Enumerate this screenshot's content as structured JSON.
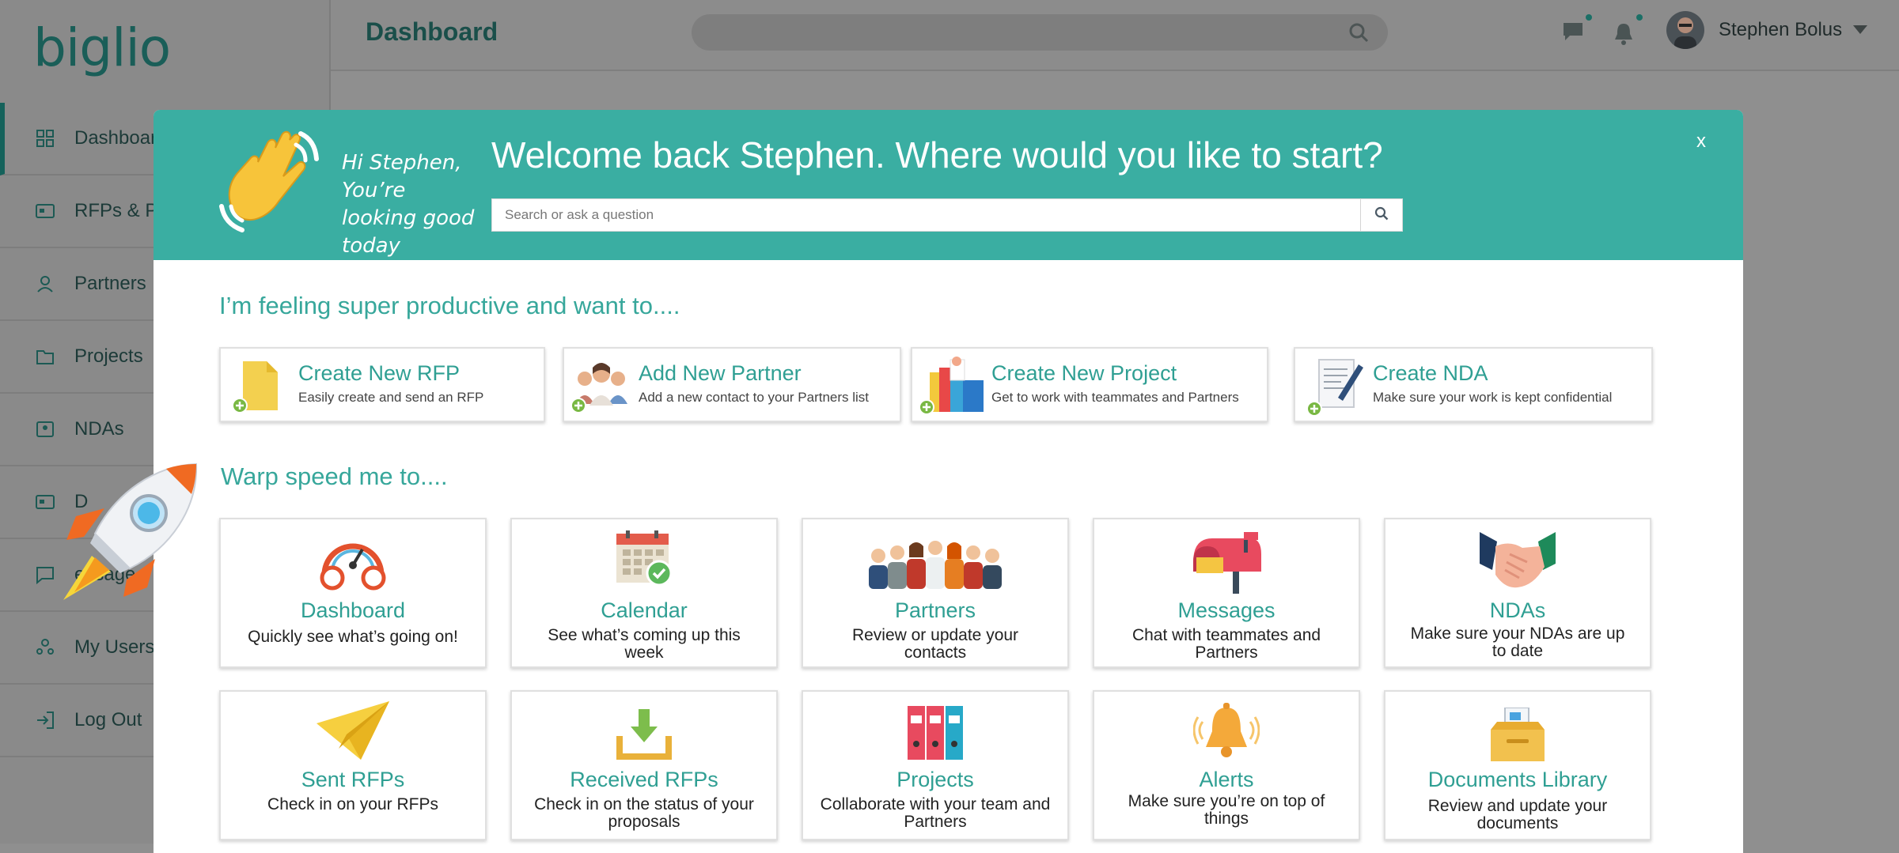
{
  "app": {
    "logo": "biglio",
    "page_title": "Dashboard",
    "user_name": "Stephen Bolus"
  },
  "sidebar": {
    "items": [
      {
        "label": "Dashboard",
        "icon": "grid-icon"
      },
      {
        "label": "RFPs & Pr",
        "icon": "rfp-card-icon"
      },
      {
        "label": "Partners",
        "icon": "person-icon"
      },
      {
        "label": "Projects",
        "icon": "folder-icon"
      },
      {
        "label": "NDAs",
        "icon": "nda-icon"
      },
      {
        "label": "D",
        "icon": "documents-icon"
      },
      {
        "label": "essage",
        "icon": "chat-icon"
      },
      {
        "label": "My Users",
        "icon": "users-icon"
      },
      {
        "label": "Log Out",
        "icon": "logout-icon"
      }
    ]
  },
  "modal": {
    "greeting": "Hi Stephen, You’re looking good today",
    "welcome": "Welcome back Stephen. Where would you like to start?",
    "search_placeholder": "Search or ask a question",
    "close_label": "x",
    "productive_heading": "I’m feeling super productive and want to....",
    "warp_heading": "Warp speed me to....",
    "quick_actions": [
      {
        "title": "Create New RFP",
        "desc": "Easily create and send an RFP",
        "icon": "new-document-icon"
      },
      {
        "title": "Add New Partner",
        "desc": "Add a new contact to your Partners list",
        "icon": "add-partner-icon"
      },
      {
        "title": "Create New Project",
        "desc": "Get to work with teammates and Partners",
        "icon": "new-project-icon"
      },
      {
        "title": "Create NDA",
        "desc": "Make sure your work is kept confidential",
        "icon": "new-nda-icon"
      }
    ],
    "shortcuts": [
      {
        "title": "Dashboard",
        "desc": "Quickly see what’s going on!",
        "icon": "gauge-icon"
      },
      {
        "title": "Calendar",
        "desc": "See what’s coming up this week",
        "icon": "calendar-icon"
      },
      {
        "title": "Partners",
        "desc": "Review or update your contacts",
        "icon": "people-group-icon"
      },
      {
        "title": "Messages",
        "desc": "Chat with teammates and Partners",
        "icon": "mailbox-icon"
      },
      {
        "title": "NDAs",
        "desc": "Make sure your NDAs are up to date",
        "icon": "handshake-icon"
      },
      {
        "title": "Sent RFPs",
        "desc": "Check in on your RFPs",
        "icon": "paper-plane-icon"
      },
      {
        "title": "Received RFPs",
        "desc": "Check in on the status of your proposals",
        "icon": "download-tray-icon"
      },
      {
        "title": "Projects",
        "desc": "Collaborate with your team and Partners",
        "icon": "binders-icon"
      },
      {
        "title": "Alerts",
        "desc": "Make sure you’re on top of things",
        "icon": "bell-icon"
      },
      {
        "title": "Documents Library",
        "desc": "Review and update your documents",
        "icon": "document-box-icon"
      }
    ]
  },
  "colors": {
    "brand_teal": "#3aaea2",
    "title_teal": "#2f9f93",
    "overlay_gray": "#8f8f8f"
  }
}
